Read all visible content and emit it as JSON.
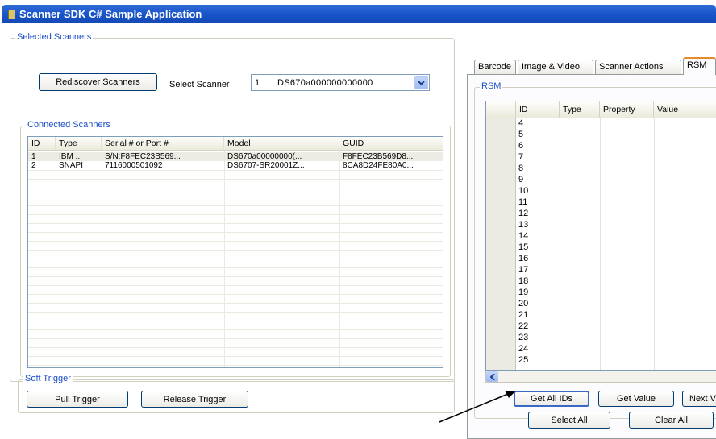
{
  "window": {
    "title": "Scanner SDK C# Sample Application"
  },
  "selected_scanners": {
    "legend": "Selected Scanners",
    "rediscover_label": "Rediscover Scanners",
    "select_scanner_label": "Select Scanner",
    "selected_id": "1",
    "selected_model": "DS670a000000000000"
  },
  "connected_scanners": {
    "legend": "Connected Scanners",
    "columns": [
      "ID",
      "Type",
      "Serial # or Port #",
      "Model",
      "GUID"
    ],
    "rows": [
      {
        "id": "1",
        "type": "IBM ...",
        "serial": "S/N:F8FEC23B569...",
        "model": "DS670a00000000(...",
        "guid": "F8FEC23B569D8..."
      },
      {
        "id": "2",
        "type": "SNAPI",
        "serial": "7116000501092",
        "model": "DS6707-SR20001Z...",
        "guid": "8CA8D24FE80A0..."
      }
    ]
  },
  "soft_trigger": {
    "legend": "Soft Trigger",
    "pull_label": "Pull Trigger",
    "release_label": "Release Trigger"
  },
  "tabs": [
    {
      "label": "Barcode"
    },
    {
      "label": "Image & Video"
    },
    {
      "label": "Scanner Actions"
    },
    {
      "label": "RSM"
    }
  ],
  "rsm": {
    "legend": "RSM",
    "columns": [
      "ID",
      "Type",
      "Property",
      "Value"
    ],
    "ids": [
      "4",
      "5",
      "6",
      "7",
      "8",
      "9",
      "10",
      "11",
      "12",
      "13",
      "14",
      "15",
      "16",
      "17",
      "18",
      "19",
      "20",
      "21",
      "22",
      "23",
      "24",
      "25"
    ],
    "get_all_ids_label": "Get All IDs",
    "get_value_label": "Get Value",
    "next_label": "Next V",
    "select_all_label": "Select All",
    "clear_all_label": "Clear All"
  }
}
